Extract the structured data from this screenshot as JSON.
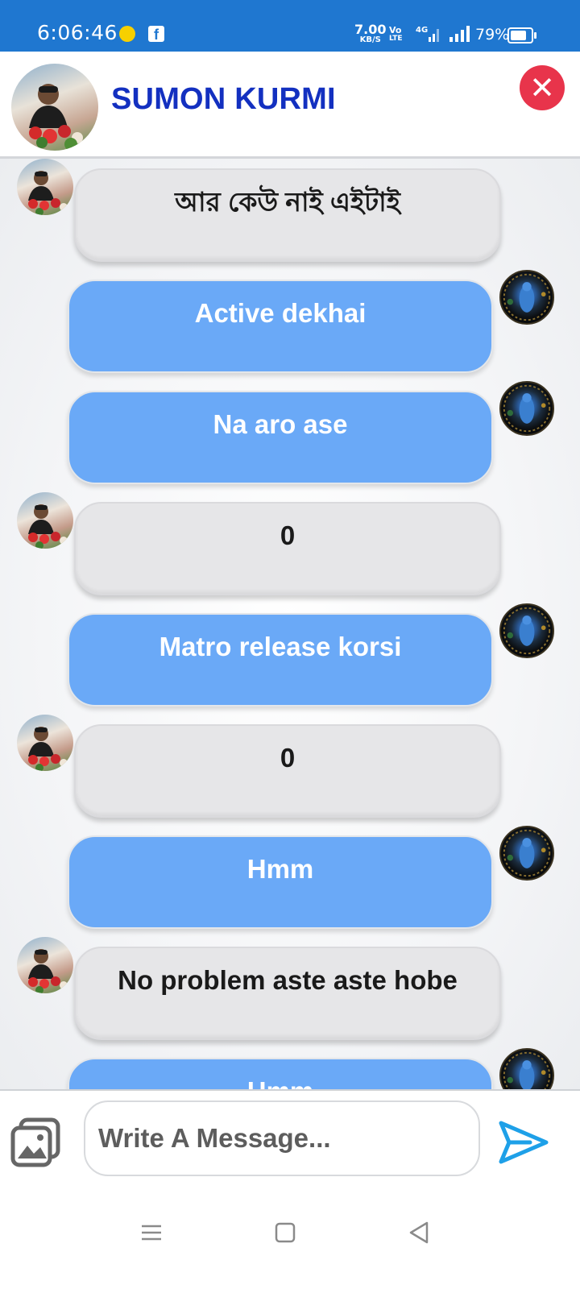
{
  "status_bar": {
    "time": "6:06:46",
    "net_speed_value": "7.00",
    "net_speed_unit": "KB/S",
    "volte_top": "Vo",
    "volte_bottom": "LTE",
    "network_type": "4G",
    "battery_percent": "79%",
    "battery_level": 0.79,
    "icons": [
      "snapchat-icon",
      "facebook-icon",
      "volte-icon",
      "4g-signal-icon",
      "signal-icon",
      "battery-icon"
    ]
  },
  "header": {
    "contact_name": "SUMON KURMI",
    "close_icon": "close-icon",
    "accent_color": "#1330c0",
    "close_color": "#e8344b"
  },
  "messages": [
    {
      "direction": "incoming",
      "text": "আর কেউ নাই এইটাই"
    },
    {
      "direction": "outgoing",
      "text": "Active dekhai"
    },
    {
      "direction": "outgoing",
      "text": "Na aro ase"
    },
    {
      "direction": "incoming",
      "text": "0"
    },
    {
      "direction": "outgoing",
      "text": "Matro release korsi"
    },
    {
      "direction": "incoming",
      "text": "0"
    },
    {
      "direction": "outgoing",
      "text": "Hmm"
    },
    {
      "direction": "incoming",
      "text": "No problem aste aste hobe"
    },
    {
      "direction": "outgoing",
      "text": "Hmm"
    }
  ],
  "colors": {
    "outgoing_bubble": "#6aa9f7",
    "incoming_bubble": "#e6e6e8",
    "status_bar": "#1f77d0"
  },
  "composer": {
    "placeholder": "Write A Message...",
    "value": "",
    "gallery_icon": "image-gallery-icon",
    "send_icon": "send-icon"
  },
  "navbar": {
    "icons": [
      "menu-icon",
      "home-icon",
      "back-icon"
    ]
  }
}
